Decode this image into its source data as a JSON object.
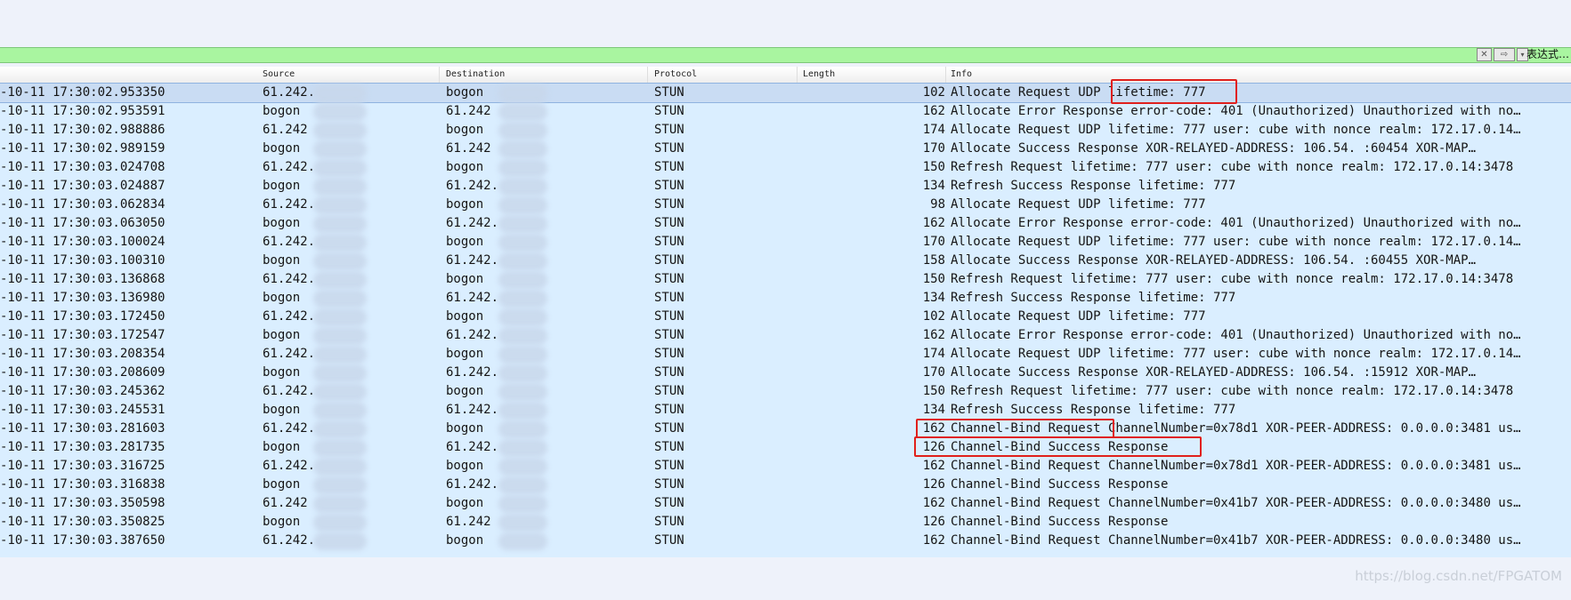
{
  "filter": {
    "clear_icon": "close-icon",
    "apply_icon": "arrow-right-icon",
    "dropdown_icon": "chevron-down-icon",
    "expression_label": "表达式…"
  },
  "columns": [
    "Source",
    "Destination",
    "Protocol",
    "Length",
    "Info"
  ],
  "rows": [
    {
      "time": "-10-11 17:30:02.953350",
      "src": "61.242.",
      "dst": "bogon",
      "proto": "STUN",
      "len": "102",
      "info": "Allocate Request UDP lifetime: 777",
      "selected": true
    },
    {
      "time": "-10-11 17:30:02.953591",
      "src": "bogon",
      "dst": "61.242",
      "proto": "STUN",
      "len": "162",
      "info": "Allocate Error Response error-code: 401 (Unauthorized) Unauthorized with no…"
    },
    {
      "time": "-10-11 17:30:02.988886",
      "src": "61.242",
      "dst": "bogon",
      "proto": "STUN",
      "len": "174",
      "info": "Allocate Request UDP lifetime: 777 user: cube with nonce realm: 172.17.0.14…"
    },
    {
      "time": "-10-11 17:30:02.989159",
      "src": "bogon",
      "dst": "61.242",
      "proto": "STUN",
      "len": "170",
      "info": "Allocate Success Response XOR-RELAYED-ADDRESS: 106.54.        :60454 XOR-MAP…"
    },
    {
      "time": "-10-11 17:30:03.024708",
      "src": "61.242.",
      "dst": "bogon",
      "proto": "STUN",
      "len": "150",
      "info": "Refresh Request lifetime: 777 user: cube with nonce realm: 172.17.0.14:3478"
    },
    {
      "time": "-10-11 17:30:03.024887",
      "src": "bogon",
      "dst": "61.242.",
      "proto": "STUN",
      "len": "134",
      "info": "Refresh Success Response lifetime: 777"
    },
    {
      "time": "-10-11 17:30:03.062834",
      "src": "61.242.",
      "dst": "bogon",
      "proto": "STUN",
      "len": "98",
      "info": "Allocate Request UDP lifetime: 777"
    },
    {
      "time": "-10-11 17:30:03.063050",
      "src": "bogon",
      "dst": "61.242.",
      "proto": "STUN",
      "len": "162",
      "info": "Allocate Error Response error-code: 401 (Unauthorized) Unauthorized with no…"
    },
    {
      "time": "-10-11 17:30:03.100024",
      "src": "61.242.",
      "dst": "bogon",
      "proto": "STUN",
      "len": "170",
      "info": "Allocate Request UDP lifetime: 777 user: cube with nonce realm: 172.17.0.14…"
    },
    {
      "time": "-10-11 17:30:03.100310",
      "src": "bogon",
      "dst": "61.242.",
      "proto": "STUN",
      "len": "158",
      "info": "Allocate Success Response XOR-RELAYED-ADDRESS: 106.54.        :60455 XOR-MAP…"
    },
    {
      "time": "-10-11 17:30:03.136868",
      "src": "61.242.",
      "dst": "bogon",
      "proto": "STUN",
      "len": "150",
      "info": "Refresh Request lifetime: 777 user: cube with nonce realm: 172.17.0.14:3478"
    },
    {
      "time": "-10-11 17:30:03.136980",
      "src": "bogon",
      "dst": "61.242.",
      "proto": "STUN",
      "len": "134",
      "info": "Refresh Success Response lifetime: 777"
    },
    {
      "time": "-10-11 17:30:03.172450",
      "src": "61.242.",
      "dst": "bogon",
      "proto": "STUN",
      "len": "102",
      "info": "Allocate Request UDP lifetime: 777"
    },
    {
      "time": "-10-11 17:30:03.172547",
      "src": "bogon",
      "dst": "61.242.",
      "proto": "STUN",
      "len": "162",
      "info": "Allocate Error Response error-code: 401 (Unauthorized) Unauthorized with no…"
    },
    {
      "time": "-10-11 17:30:03.208354",
      "src": "61.242.",
      "dst": "bogon",
      "proto": "STUN",
      "len": "174",
      "info": "Allocate Request UDP lifetime: 777 user: cube with nonce realm: 172.17.0.14…"
    },
    {
      "time": "-10-11 17:30:03.208609",
      "src": "bogon",
      "dst": "61.242.",
      "proto": "STUN",
      "len": "170",
      "info": "Allocate Success Response XOR-RELAYED-ADDRESS: 106.54.        :15912 XOR-MAP…"
    },
    {
      "time": "-10-11 17:30:03.245362",
      "src": "61.242.",
      "dst": "bogon",
      "proto": "STUN",
      "len": "150",
      "info": "Refresh Request lifetime: 777 user: cube with nonce realm: 172.17.0.14:3478"
    },
    {
      "time": "-10-11 17:30:03.245531",
      "src": "bogon",
      "dst": "61.242.",
      "proto": "STUN",
      "len": "134",
      "info": "Refresh Success Response lifetime: 777"
    },
    {
      "time": "-10-11 17:30:03.281603",
      "src": "61.242.",
      "dst": "bogon",
      "proto": "STUN",
      "len": "162",
      "info": "Channel-Bind Request ChannelNumber=0x78d1 XOR-PEER-ADDRESS: 0.0.0.0:3481 us…"
    },
    {
      "time": "-10-11 17:30:03.281735",
      "src": "bogon",
      "dst": "61.242.",
      "proto": "STUN",
      "len": "126",
      "info": "Channel-Bind Success Response"
    },
    {
      "time": "-10-11 17:30:03.316725",
      "src": "61.242.",
      "dst": "bogon",
      "proto": "STUN",
      "len": "162",
      "info": "Channel-Bind Request ChannelNumber=0x78d1 XOR-PEER-ADDRESS: 0.0.0.0:3481 us…"
    },
    {
      "time": "-10-11 17:30:03.316838",
      "src": "bogon",
      "dst": "61.242.",
      "proto": "STUN",
      "len": "126",
      "info": "Channel-Bind Success Response"
    },
    {
      "time": "-10-11 17:30:03.350598",
      "src": "61.242",
      "dst": "bogon",
      "proto": "STUN",
      "len": "162",
      "info": "Channel-Bind Request ChannelNumber=0x41b7 XOR-PEER-ADDRESS: 0.0.0.0:3480 us…"
    },
    {
      "time": "-10-11 17:30:03.350825",
      "src": "bogon",
      "dst": "61.242",
      "proto": "STUN",
      "len": "126",
      "info": "Channel-Bind Success Response"
    },
    {
      "time": "-10-11 17:30:03.387650",
      "src": "61.242.",
      "dst": "bogon",
      "proto": "STUN",
      "len": "162",
      "info": "Channel-Bind Request ChannelNumber=0x41b7 XOR-PEER-ADDRESS: 0.0.0.0:3480 us…"
    }
  ],
  "watermark": "https://blog.csdn.net/FPGATOM",
  "colors": {
    "filter_bg": "#a9f5a0",
    "row_bg": "#daeeff",
    "selected_bg": "#c9dcf3",
    "highlight": "#e0201c"
  }
}
